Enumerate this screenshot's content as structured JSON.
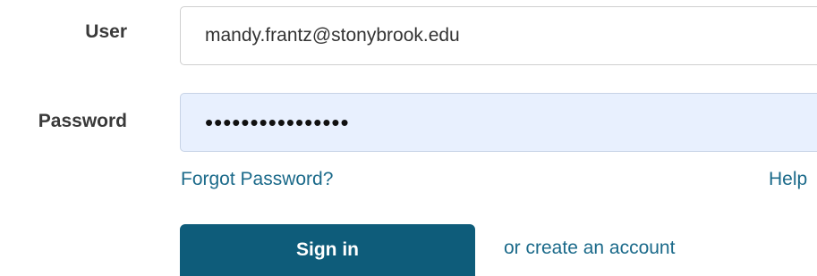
{
  "form": {
    "user_label": "User",
    "user_value": "mandy.frantz@stonybrook.edu",
    "password_label": "Password",
    "password_value": "••••••••••••••••"
  },
  "links": {
    "forgot_password": "Forgot Password?",
    "help": "Help"
  },
  "actions": {
    "sign_in_label": "Sign in",
    "create_account_label": "or create an account"
  },
  "colors": {
    "button_bg": "#0e5c7a",
    "link": "#1b6a8a",
    "password_field_bg": "#e8f0fe"
  }
}
